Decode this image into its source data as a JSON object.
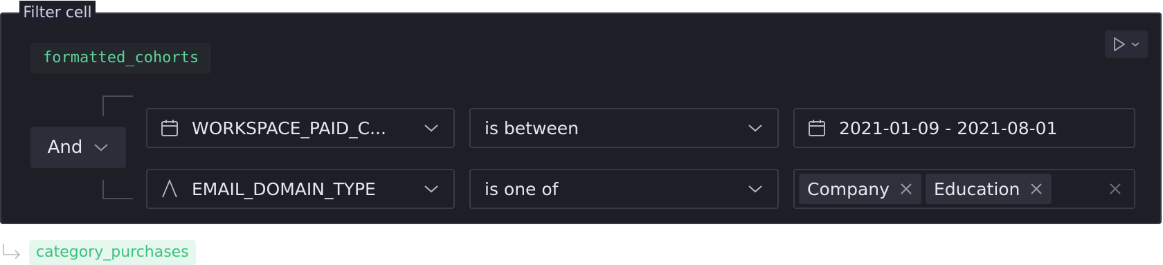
{
  "cell_label": "Filter cell",
  "dataframe": "formatted_cohorts",
  "logic": "And",
  "filters": [
    {
      "column_icon": "calendar-icon",
      "column": "WORKSPACE_PAID_C...",
      "operator": "is between",
      "value_icon": "calendar-icon",
      "value": "2021-01-09 - 2021-08-01"
    },
    {
      "column_icon": "text-type-icon",
      "column": "EMAIL_DOMAIN_TYPE",
      "operator": "is one of",
      "values": [
        "Company",
        "Education"
      ]
    }
  ],
  "output": "category_purchases",
  "colors": {
    "cell_bg": "#1e1e27",
    "accent_green": "#5ed39a",
    "output_green": "#3ac27f"
  }
}
